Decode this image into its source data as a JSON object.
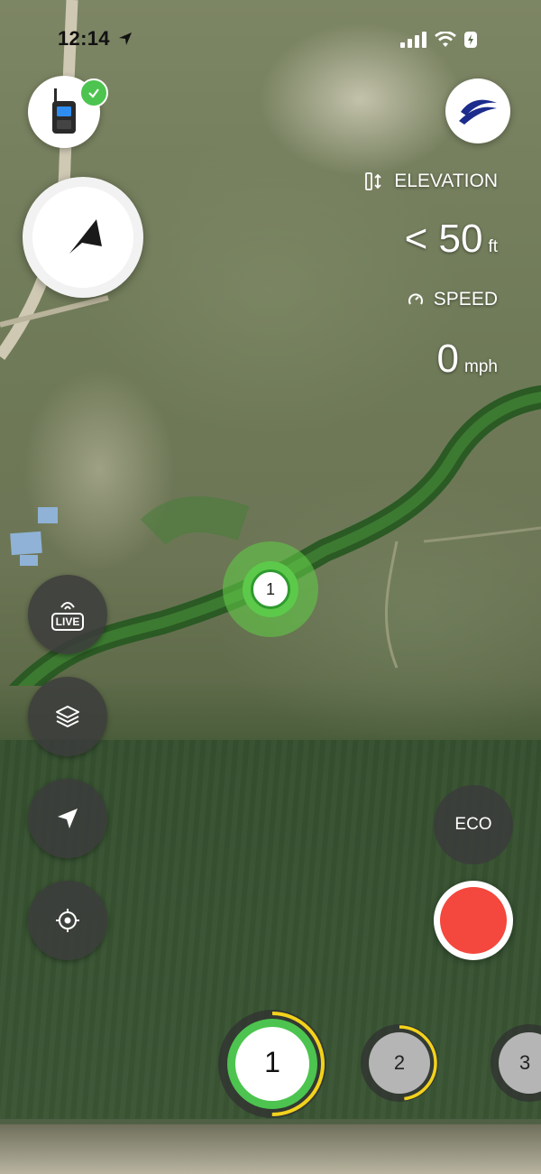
{
  "status_bar": {
    "time": "12:14"
  },
  "telemetry": {
    "elevation_label": "ELEVATION",
    "elevation_value": "< 50",
    "elevation_unit": "ft",
    "speed_label": "SPEED",
    "speed_value": "0",
    "speed_unit": "mph"
  },
  "map_marker": {
    "label": "1"
  },
  "left_controls": {
    "live_label": "LIVE"
  },
  "eco_label": "ECO",
  "channels": [
    {
      "label": "1"
    },
    {
      "label": "2"
    },
    {
      "label": "3"
    }
  ],
  "colors": {
    "accent_green": "#4cc44f",
    "record_red": "#f4473d",
    "progress_yellow": "#f3d21b"
  },
  "icons": {
    "radio": "walkie-talkie-icon",
    "brand": "brand-logo",
    "compass": "navigation-arrow-icon",
    "live": "live-broadcast-icon",
    "layers": "layers-icon",
    "locate": "location-arrow-icon",
    "crosshair": "crosshair-icon"
  }
}
